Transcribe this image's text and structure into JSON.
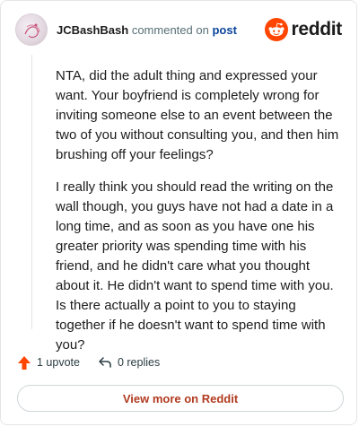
{
  "comment": {
    "username": "JCBashBash",
    "action_text": "commented on",
    "post_link": "post",
    "paragraphs": [
      "NTA, did the adult thing and expressed your want. Your boyfriend is completely wrong for inviting someone else to an event between the two of you without consulting you, and then him brushing off your feelings?",
      "I really think you should read the writing on the wall though, you guys have not had a date in a long time, and as soon as you have one his greater priority was spending time with his friend, and he didn't care what you thought about it. He didn't want to spend time with you. Is there actually a point to you to staying together if he doesn't want to spend time with you?"
    ],
    "upvotes_label": "1 upvote",
    "replies_label": "0 replies"
  },
  "brand": {
    "wordmark": "reddit",
    "icon": "reddit-snoo-icon",
    "accent_color": "#ff4500"
  },
  "footer": {
    "view_more_label": "View more on Reddit"
  }
}
